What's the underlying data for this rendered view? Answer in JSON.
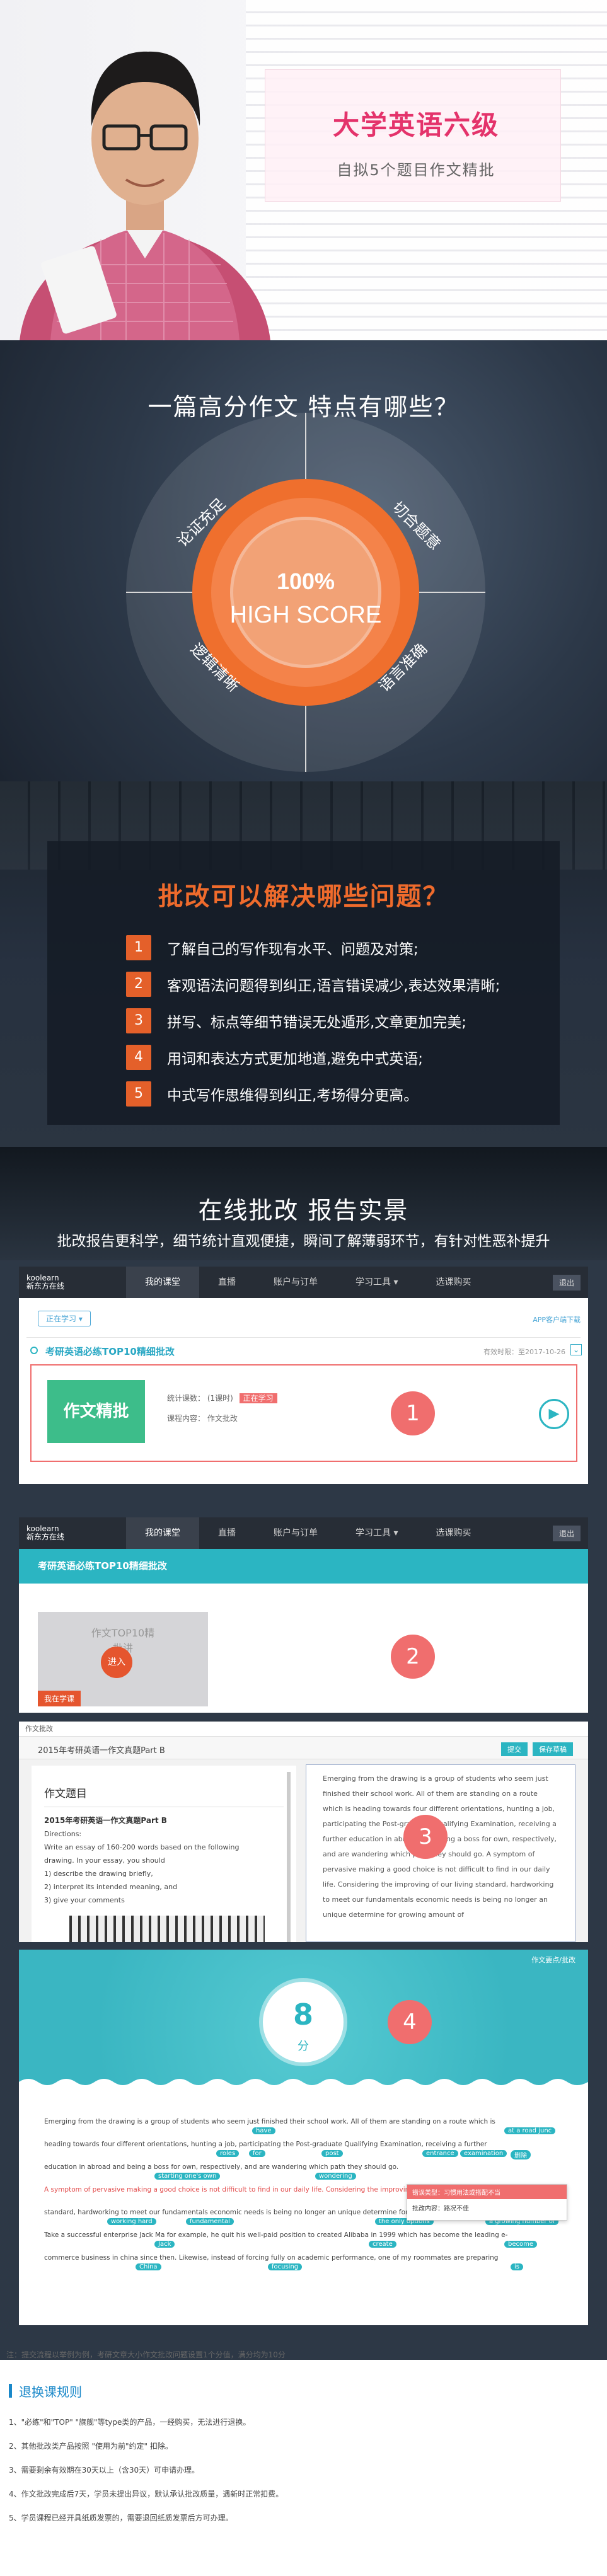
{
  "hero": {
    "title": "大学英语六级",
    "subtitle": "自拟5个题目作文精批"
  },
  "features": {
    "question": "一篇高分作文  特点有哪些？",
    "center_pct": "100%",
    "center_text": "HIGH SCORE",
    "quadrants": [
      "论证充足",
      "切合题意",
      "逻辑清晰",
      "语言准确"
    ]
  },
  "problems": {
    "title": "批改可以解决哪些问题？",
    "items": [
      {
        "n": "1",
        "text": "了解自己的写作现有水平、问题及对策;"
      },
      {
        "n": "2",
        "text": "客观语法问题得到纠正,语言错误减少,表达效果清晰;"
      },
      {
        "n": "3",
        "text": "拼写、标点等细节错误无处遁形,文章更加完美;"
      },
      {
        "n": "4",
        "text": "用词和表达方式更加地道,避免中式英语;"
      },
      {
        "n": "5",
        "text": "中式写作思维得到纠正,考场得分更高。"
      }
    ]
  },
  "report": {
    "title": "在线批改 报告实景",
    "subtitle": "批改报告更科学，细节统计直观便捷，瞬间了解薄弱环节，有针对性恶补提升"
  },
  "nav": {
    "logo_line1": "koolearn",
    "logo_line2": "新东方在线",
    "items": [
      "我的课堂",
      "直播",
      "账户与订单",
      "学习工具 ▾",
      "选课购买"
    ],
    "exit": "退出"
  },
  "shot1": {
    "filter": "正在学习 ▾",
    "app_link": "APP客户端下载",
    "course_title": "考研英语必练TOP10精细批改",
    "validity": "有效时限：至2017-10-26",
    "thumb_text": "作文精批",
    "stats_label": "统计课数：",
    "stats_value": "(1课时)",
    "status": "正在学习",
    "content_label": "课程内容：",
    "content_value": "作文批改",
    "badge": "1"
  },
  "shot2": {
    "header": "考研英语必练TOP10精细批改",
    "card_text": "作文TOP10精\n批讲\n已购",
    "enter": "进入",
    "tag": "我在学课",
    "badge": "2"
  },
  "shot3": {
    "top_label": "作文批改",
    "title": "2015年考研英语一作文真题Part B",
    "btn1": "提交",
    "btn2": "保存草稿",
    "left_head": "作文题目",
    "left_title": "2015年考研英语一作文真题Part B",
    "prompt": [
      "Directions:",
      "Write an essay of 160-200 words based on the following",
      "drawing. In your essay, you should",
      "1) describe the drawing briefly,",
      "2) interpret its intended meaning, and",
      "3) give your comments"
    ],
    "essay": "Emerging from the drawing is a group of students who seem just finished their school work. All of them are standing on a route which is heading towards four different orientations, hunting a job, participating the Post-graduate Qualifying Examination, receiving a further education in abroad and being a boss for own, respectively, and are wandering which path they should go. A symptom of pervasive making a good choice is not difficult to find in our daily life. Considering the improving of our living standard, hardworking to meet our fundamentals economic needs is being no longer an unique determine for growing amount of",
    "badge": "3"
  },
  "shot4": {
    "top_right": "作文要点/批改",
    "score": "8",
    "score_unit": "分",
    "badge": "4",
    "lines": [
      "Emerging from the drawing is a group of students who seem just finished their school work. All of them are standing on a route which is",
      "heading towards four different orientations, hunting a job, participating the Post-graduate Qualifying Examination, receiving a further",
      "education in abroad and being a boss for own, respectively, and are wandering which path they should go.",
      "A symptom of pervasive making a good choice is not difficult to find in our daily life. Considering the improving of our living",
      "standard, hardworking to meet our fundamentals economic needs is being no longer an unique determine for growing amount of students.",
      "Take a successful enterprise Jack Ma for example, he quit his well-paid position to created Alibaba in 1999 which has become the leading e-",
      "commerce business in china since then. Likewise, instead of forcing fully on academic performance, one of my roommates are preparing"
    ],
    "tips": [
      "have",
      "at a road junc",
      "roles",
      "for",
      "post",
      "entrance",
      "examination",
      "删除",
      "starting one's own",
      "wondering",
      "working hard",
      "fundamental",
      "the only options",
      "a growing number of",
      "Jack",
      "create",
      "become",
      "China",
      "focusing",
      "is"
    ],
    "popup_l1": "错误类型：习惯用法或搭配不当",
    "popup_l2": "批改内容：路况不佳"
  },
  "footnote": "注：提交流程以举例为例，考研文章大小作文批改问题设置1个分值，满分均为10分",
  "rules": {
    "title": "退换课规则",
    "items": [
      "1、\"必练\"和\"TOP\" \"旗舰\"等type类的产品，一经购买，无法进行退换。",
      "2、其他批改类产品按照 \"使用为前\"约定\" 扣除。",
      "3、需要剩余有效期在30天以上（含30天）可申请办理。",
      "4、作文批改完成后7天，学员未提出异议，默认承认批改质量，遇新时正常扣费。",
      "5、学员课程已经开具纸质发票的，需要退回纸质发票后方可办理。"
    ]
  }
}
